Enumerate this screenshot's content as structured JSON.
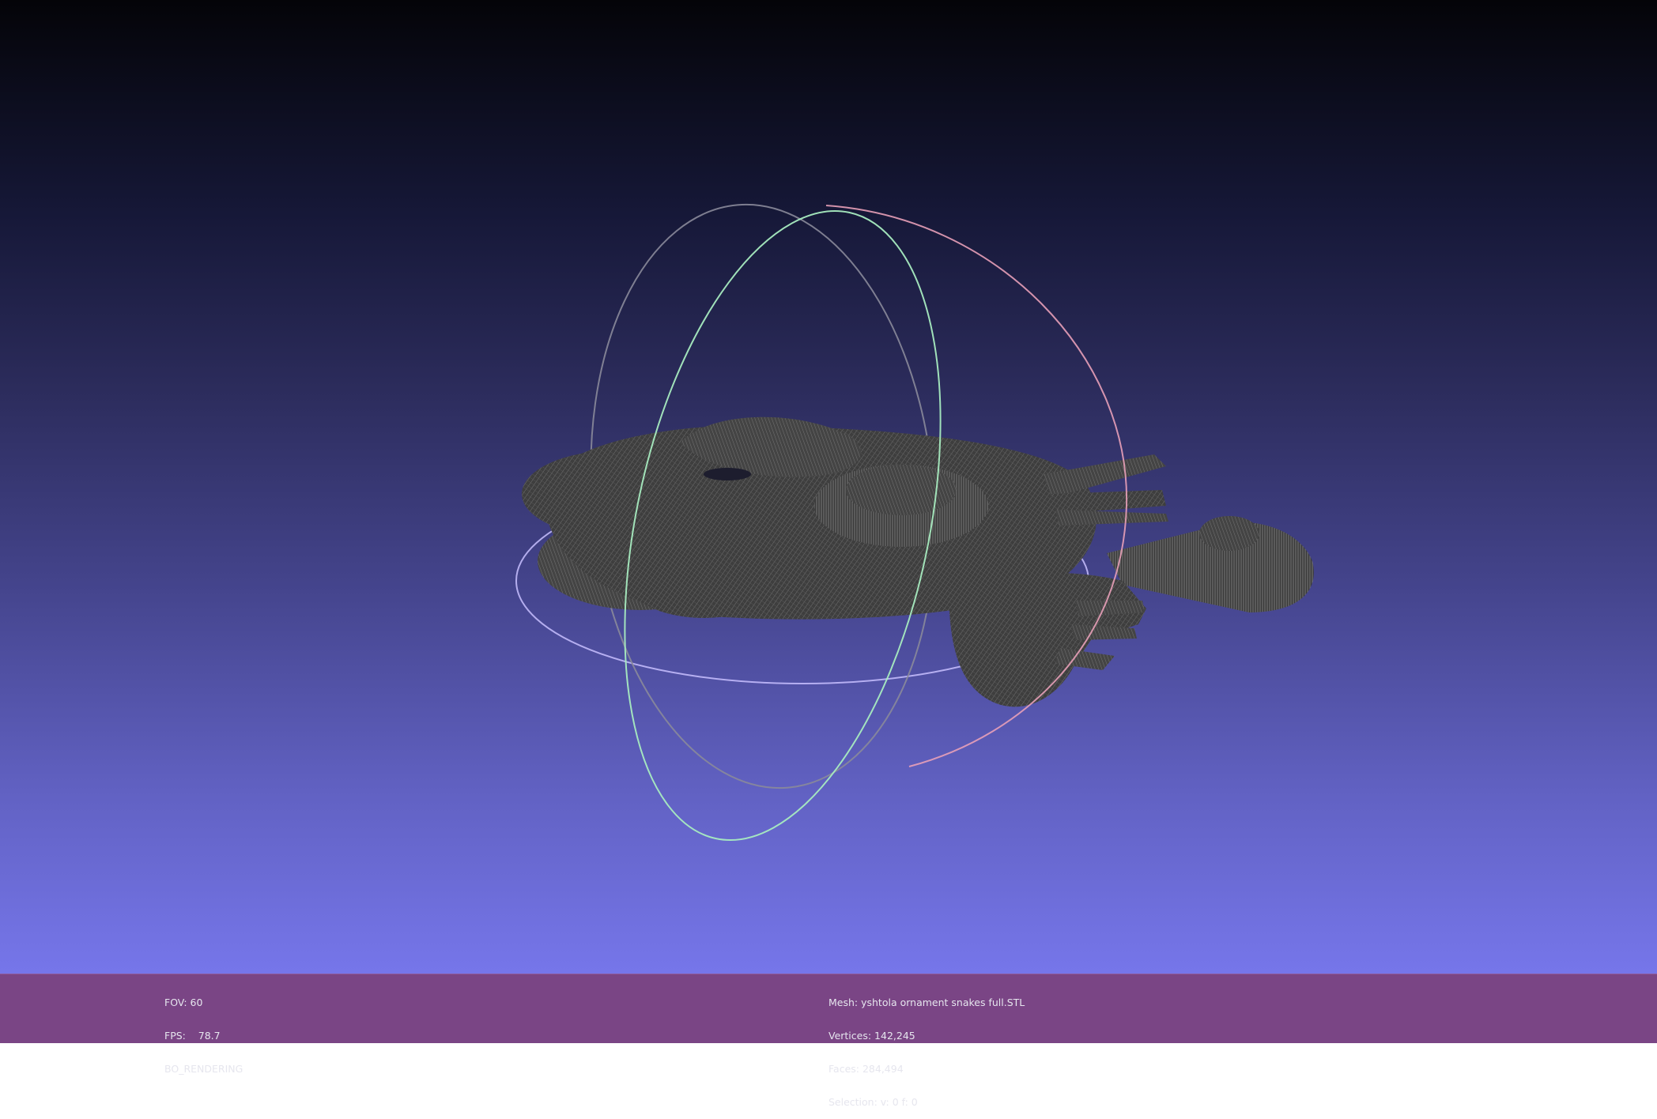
{
  "viewer": {
    "background_top_color": "#040408",
    "background_bottom_color": "#7676ea",
    "status_bar_color": "#7a4585",
    "mesh_color": "#4a4a4a",
    "trackball": {
      "x_ring_color": "#e8a0b8",
      "y_ring_color": "#a8ecc0",
      "z_ring_color": "#c8c0ff"
    }
  },
  "status": {
    "fov": "FOV: 60",
    "fps": "FPS:    78.7",
    "render_mode": "BO_RENDERING",
    "mesh": "Mesh: yshtola ornament snakes full.STL",
    "vertices": "Vertices: 142,245",
    "faces": "Faces: 284,494",
    "selection": "Selection: v: 0 f: 0"
  }
}
